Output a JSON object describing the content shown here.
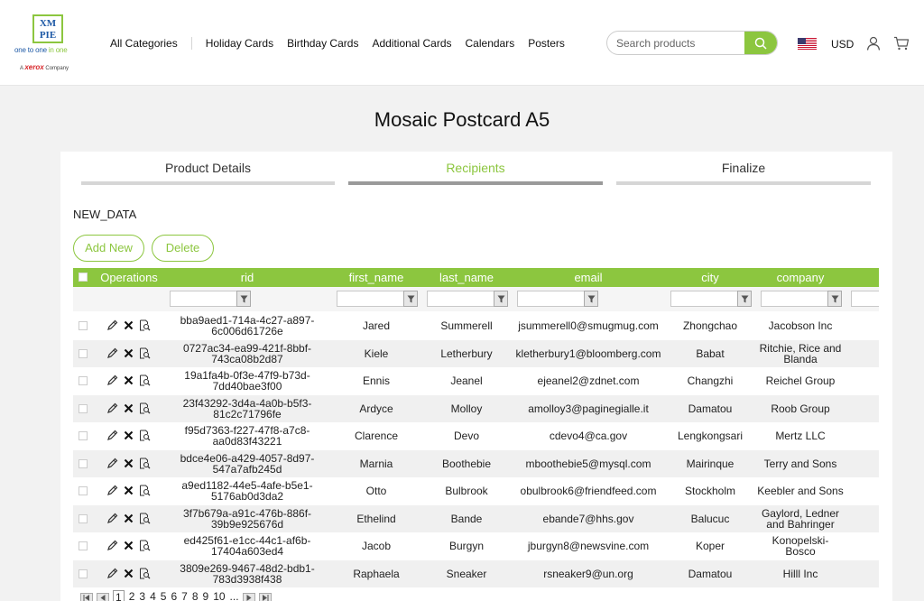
{
  "header": {
    "logo": {
      "top": "XM",
      "bottom": "PIE",
      "tagline_a": "one to one",
      "tagline_b": " in one",
      "xerox_prefix": "A",
      "xerox_brand": "xerox",
      "xerox_suffix": " Company"
    },
    "nav": [
      "All Categories",
      "Holiday Cards",
      "Birthday Cards",
      "Additional Cards",
      "Calendars",
      "Posters"
    ],
    "search": {
      "placeholder": "Search products"
    },
    "currency": "USD"
  },
  "page": {
    "title": "Mosaic Postcard A5"
  },
  "steps": [
    {
      "label": "Product Details",
      "active": false
    },
    {
      "label": "Recipients",
      "active": true
    },
    {
      "label": "Finalize",
      "active": false
    }
  ],
  "section": {
    "title": "NEW_DATA",
    "add_label": "Add New",
    "delete_label": "Delete"
  },
  "grid": {
    "columns": [
      "Operations",
      "rid",
      "first_name",
      "last_name",
      "email",
      "city",
      "company"
    ],
    "rows": [
      {
        "rid": "bba9aed1-714a-4c27-a897-6c006d61726e",
        "first_name": "Jared",
        "last_name": "Summerell",
        "email": "jsummerell0@smugmug.com",
        "city": "Zhongchao",
        "company": "Jacobson Inc"
      },
      {
        "rid": "0727ac34-ea99-421f-8bbf-743ca08b2d87",
        "first_name": "Kiele",
        "last_name": "Letherbury",
        "email": "kletherbury1@bloomberg.com",
        "city": "Babat",
        "company": "Ritchie, Rice and Blanda"
      },
      {
        "rid": "19a1fa4b-0f3e-47f9-b73d-7dd40bae3f00",
        "first_name": "Ennis",
        "last_name": "Jeanel",
        "email": "ejeanel2@zdnet.com",
        "city": "Changzhi",
        "company": "Reichel Group"
      },
      {
        "rid": "23f43292-3d4a-4a0b-b5f3-81c2c71796fe",
        "first_name": "Ardyce",
        "last_name": "Molloy",
        "email": "amolloy3@paginegialle.it",
        "city": "Damatou",
        "company": "Roob Group"
      },
      {
        "rid": "f95d7363-f227-47f8-a7c8-aa0d83f43221",
        "first_name": "Clarence",
        "last_name": "Devo",
        "email": "cdevo4@ca.gov",
        "city": "Lengkongsari",
        "company": "Mertz LLC"
      },
      {
        "rid": "bdce4e06-a429-4057-8d97-547a7afb245d",
        "first_name": "Marnia",
        "last_name": "Boothebie",
        "email": "mboothebie5@mysql.com",
        "city": "Mairinque",
        "company": "Terry and Sons"
      },
      {
        "rid": "a9ed1182-44e5-4afe-b5e1-5176ab0d3da2",
        "first_name": "Otto",
        "last_name": "Bulbrook",
        "email": "obulbrook6@friendfeed.com",
        "city": "Stockholm",
        "company": "Keebler and Sons"
      },
      {
        "rid": "3f7b679a-a91c-476b-886f-39b9e925676d",
        "first_name": "Ethelind",
        "last_name": "Bande",
        "email": "ebande7@hhs.gov",
        "city": "Balucuc",
        "company": "Gaylord, Ledner and Bahringer"
      },
      {
        "rid": "ed425f61-e1cc-44c1-af6b-17404a603ed4",
        "first_name": "Jacob",
        "last_name": "Burgyn",
        "email": "jburgyn8@newsvine.com",
        "city": "Koper",
        "company": "Konopelski-Bosco"
      },
      {
        "rid": "3809e269-9467-48d2-bdb1-783d3938f438",
        "first_name": "Raphaela",
        "last_name": "Sneaker",
        "email": "rsneaker9@un.org",
        "city": "Damatou",
        "company": "Hilll Inc"
      }
    ]
  },
  "pager": {
    "pages": [
      "1",
      "2",
      "3",
      "4",
      "5",
      "6",
      "7",
      "8",
      "9",
      "10",
      "..."
    ],
    "current": "1"
  },
  "colors": {
    "accent": "#8cc63f",
    "brand_blue": "#1f5aa6",
    "xerox_red": "#d7262a"
  }
}
